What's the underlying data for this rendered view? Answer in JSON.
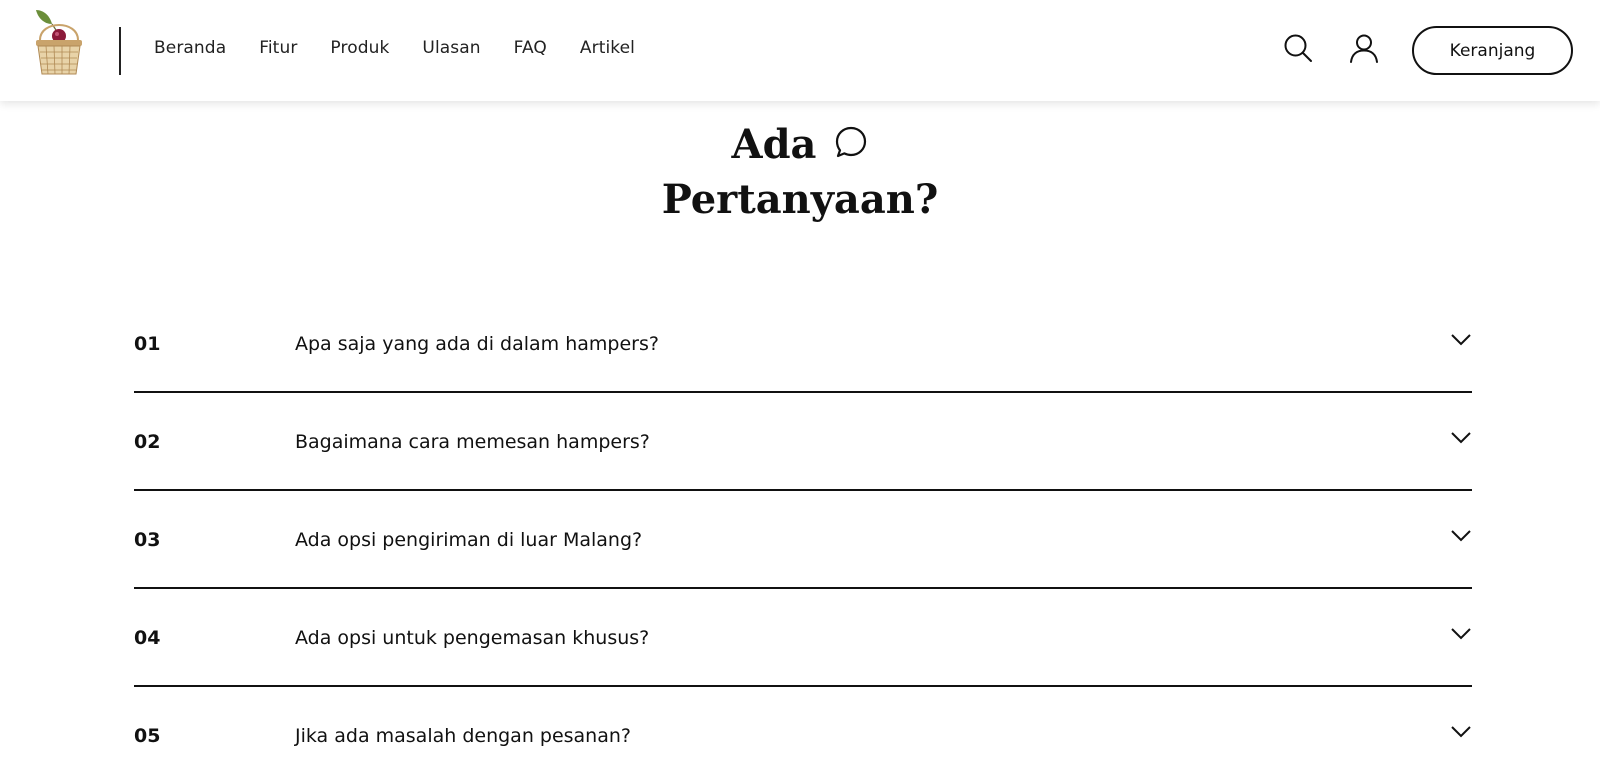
{
  "nav": {
    "items": [
      "Beranda",
      "Fitur",
      "Produk",
      "Ulasan",
      "FAQ",
      "Artikel"
    ],
    "cart_label": "Keranjang"
  },
  "icons": {
    "logo": "fruit-basket-logo",
    "search": "search-icon",
    "user": "user-icon",
    "title_decor": "chat-bubble-icon",
    "expand": "chevron-down-icon"
  },
  "section": {
    "title_line1": "Ada",
    "title_line2": "Pertanyaan?"
  },
  "faq": [
    {
      "num": "01",
      "question": "Apa saja yang ada di dalam hampers?"
    },
    {
      "num": "02",
      "question": "Bagaimana cara memesan hampers?"
    },
    {
      "num": "03",
      "question": "Ada opsi pengiriman di luar Malang?"
    },
    {
      "num": "04",
      "question": "Ada opsi untuk pengemasan khusus?"
    },
    {
      "num": "05",
      "question": "Jika ada masalah dengan pesanan?"
    }
  ],
  "colors": {
    "text": "#111111",
    "background": "#ffffff",
    "logo_fruit": "#8b1a3a",
    "logo_leaf": "#6b8e3a",
    "logo_basket": "#c9a36b"
  }
}
